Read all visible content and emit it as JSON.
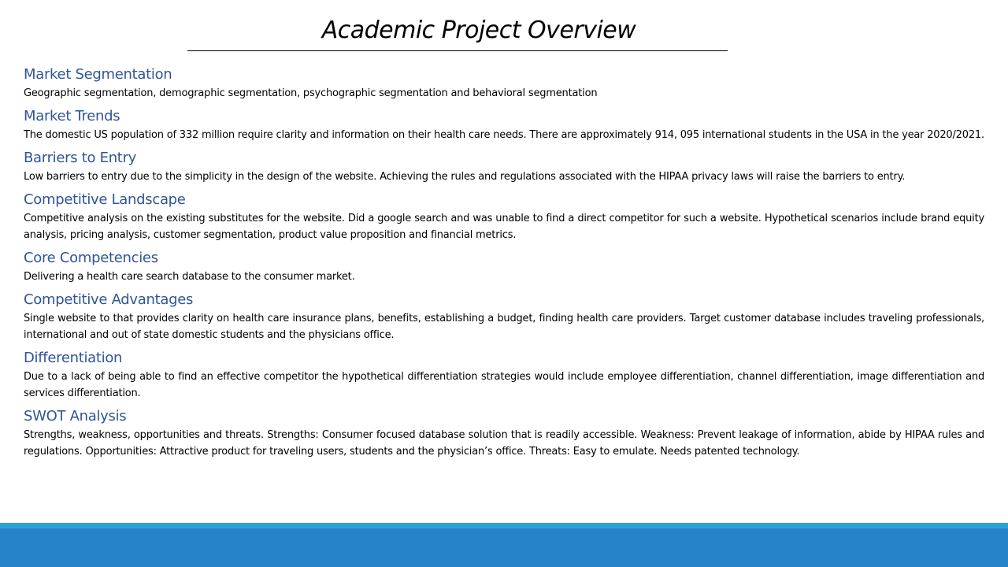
{
  "slide": {
    "title": "Academic Project Overview",
    "sections": [
      {
        "heading": "Market Segmentation",
        "body": "Geographic segmentation, demographic segmentation, psychographic segmentation and behavioral segmentation"
      },
      {
        "heading": "Market Trends",
        "body": "The domestic US population of 332 million require clarity and information on their health care needs.  There are approximately 914, 095 international students in the USA in the year 2020/2021."
      },
      {
        "heading": "Barriers to Entry",
        "body": "Low barriers to entry due to the simplicity in the design of the website. Achieving the rules and regulations associated with the  HIPAA privacy laws will raise the barriers to entry."
      },
      {
        "heading": "Competitive Landscape",
        "body": "Competitive analysis on the existing substitutes for the website.  Did a google search and was unable to find a direct competitor for such a website. Hypothetical scenarios include brand equity analysis, pricing analysis, customer segmentation, product value proposition and financial metrics."
      },
      {
        "heading": "Core Competencies",
        "body": "Delivering a health care search database to the consumer market."
      },
      {
        "heading": "Competitive Advantages",
        "body": "Single website to that provides clarity on health care insurance plans, benefits, establishing a budget, finding health care providers. Target customer database includes traveling professionals, international and out of state domestic students and the physicians office."
      },
      {
        "heading": "Differentiation",
        "body": "Due to a lack of being able to find an effective competitor the hypothetical differentiation strategies would include employee differentiation, channel differentiation, image differentiation and services differentiation."
      },
      {
        "heading": "SWOT Analysis",
        "body": "Strengths, weakness, opportunities and threats.  Strengths: Consumer focused database solution that is readily accessible. Weakness: Prevent leakage of information, abide by HIPAA rules and regulations. Opportunities: Attractive product  for traveling users, students and the physician’s office. Threats: Easy to emulate. Needs patented technology."
      }
    ]
  },
  "colors": {
    "heading": "#2f5597",
    "footer_strip": "#29a3da",
    "footer_band": "#2682c9"
  }
}
